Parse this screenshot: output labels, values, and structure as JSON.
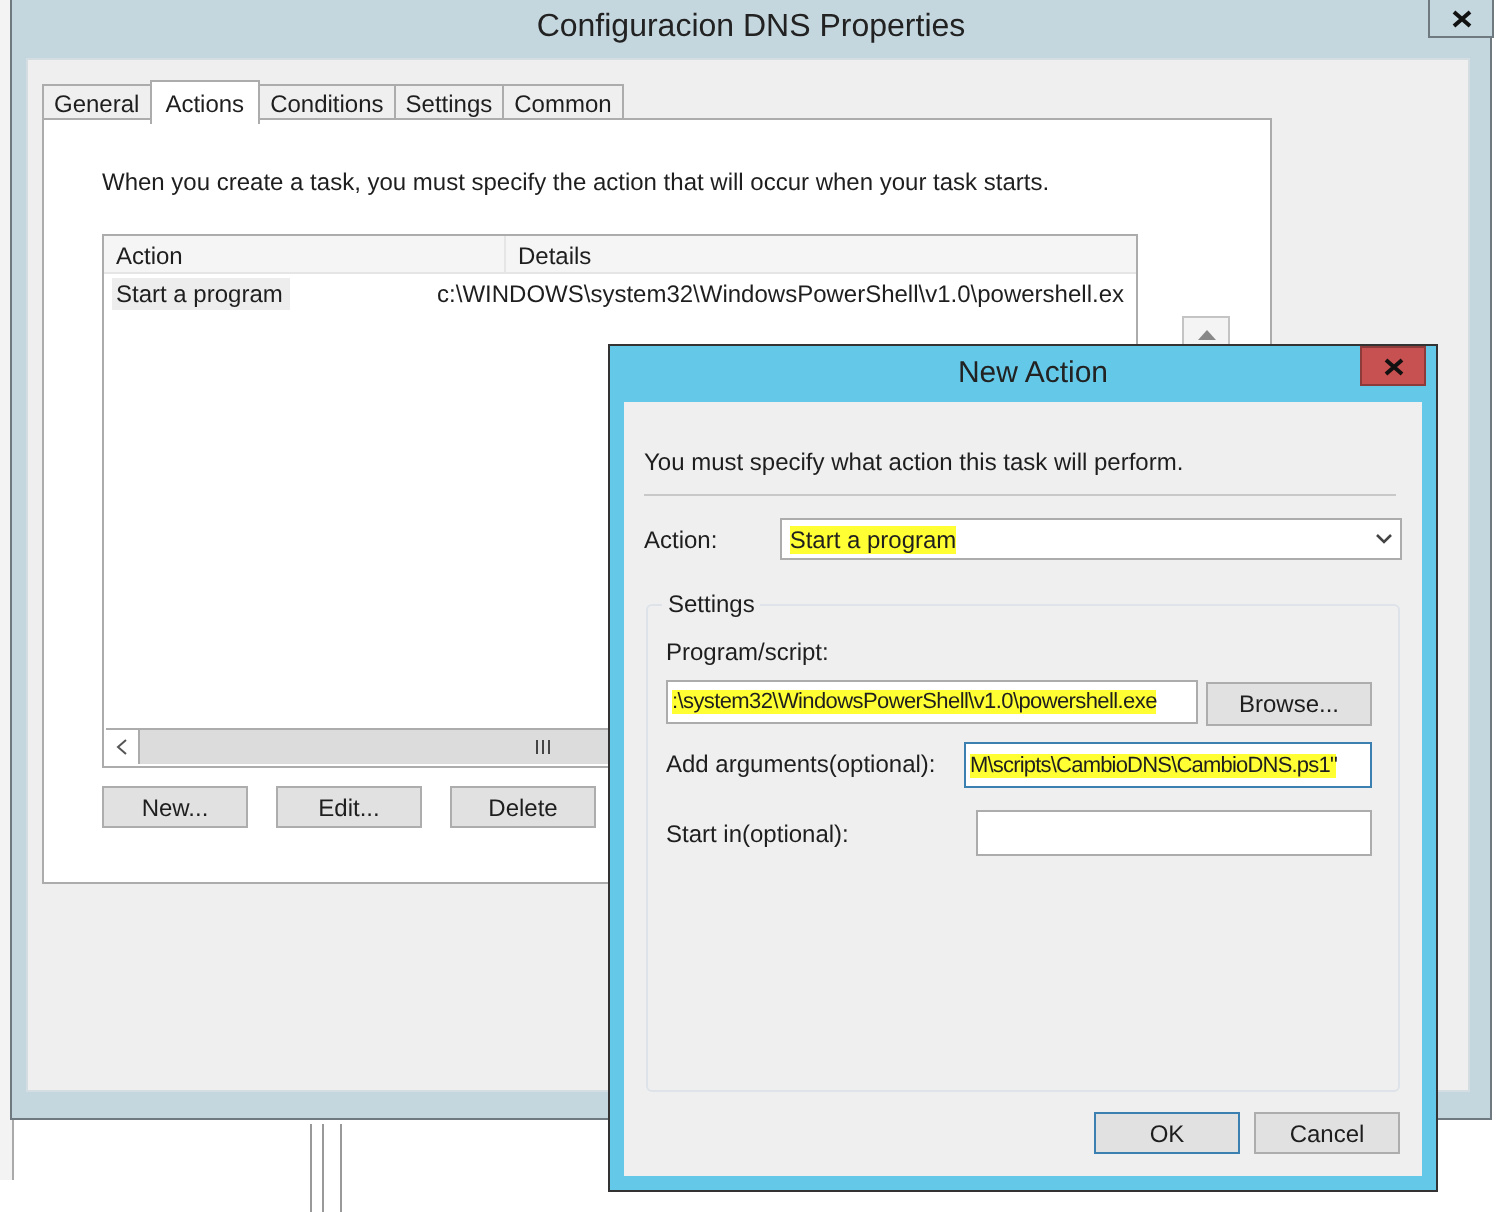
{
  "window": {
    "title": "Configuracion DNS Properties"
  },
  "tabs": [
    {
      "label": "General",
      "selected": false
    },
    {
      "label": "Actions",
      "selected": true
    },
    {
      "label": "Conditions",
      "selected": false
    },
    {
      "label": "Settings",
      "selected": false
    },
    {
      "label": "Common",
      "selected": false
    }
  ],
  "description": "When you create a task, you must specify the action that will occur when your task starts.",
  "table": {
    "columns": [
      "Action",
      "Details"
    ],
    "rows": [
      {
        "cells": [
          "Start a program",
          "c:\\WINDOWS\\system32\\WindowsPowerShell\\v1.0\\powershell.ex"
        ],
        "selected": true
      }
    ]
  },
  "buttons": [
    "New...",
    "Edit...",
    "Delete"
  ],
  "dialog": {
    "title": "New Action",
    "instruction": "You must specify what action this task will perform.",
    "action": {
      "label": "Action:",
      "value": "Start a program",
      "highlighted": true
    },
    "settings": {
      "title": "Settings",
      "program": {
        "label": "Program/script:",
        "value": ":\\system32\\WindowsPowerShell\\v1.0\\powershell.exe",
        "highlighted": true
      },
      "browse": "Browse...",
      "arguments": {
        "label": "Add arguments(optional):",
        "value": "M\\scripts\\CambioDNS\\CambioDNS.ps1\"",
        "highlighted": true
      },
      "start_in": {
        "label": "Start in(optional):"
      }
    },
    "buttons": [
      {
        "label": "OK",
        "default": true
      },
      {
        "label": "Cancel",
        "default": false
      }
    ]
  }
}
